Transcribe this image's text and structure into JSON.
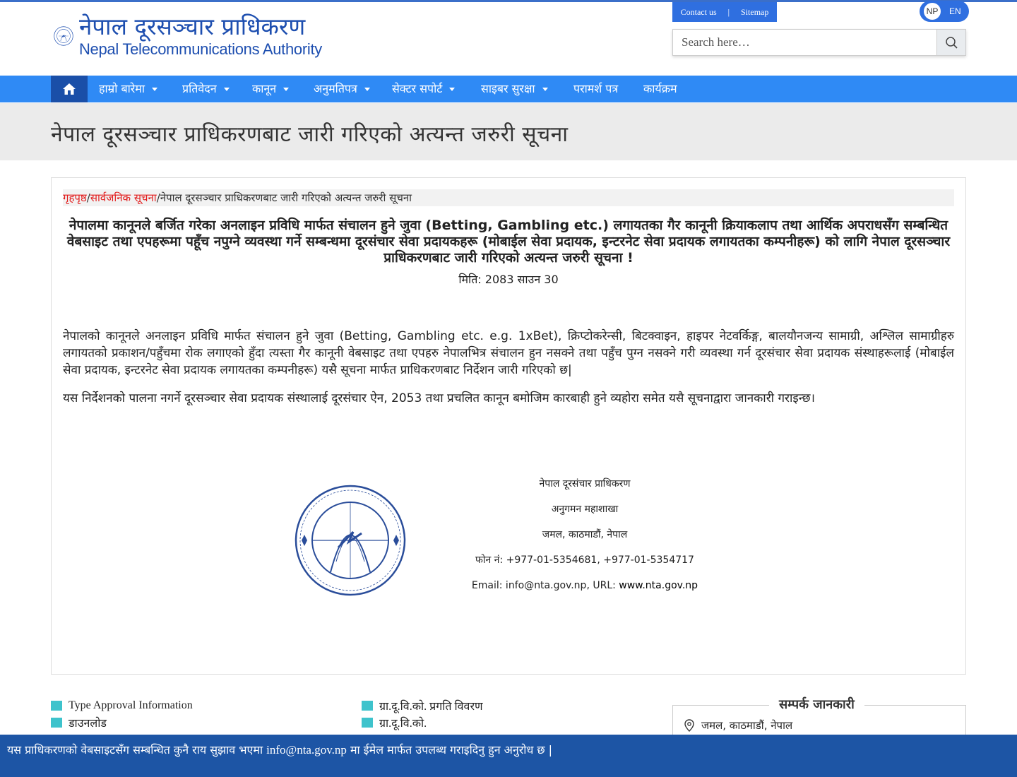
{
  "header": {
    "logo_np": "नेपाल दूरसञ्चार प्राधिकरण",
    "logo_en": "Nepal Telecommunications Authority",
    "contact_label": "Contact us",
    "separator": "|",
    "sitemap_label": "Sitemap",
    "lang_np": "NP",
    "lang_en": "EN",
    "search_placeholder": "Search here…"
  },
  "nav": {
    "items": [
      {
        "label": "हाम्रो बारेमा"
      },
      {
        "label": "प्रतिवेदन"
      },
      {
        "label": "कानून"
      },
      {
        "label": "अनुमतिपत्र"
      },
      {
        "label": "सेक्टर सपोर्ट"
      },
      {
        "label": "साइबर सुरक्षा"
      },
      {
        "label": "परामर्श पत्र"
      },
      {
        "label": "कार्यक्रम"
      }
    ]
  },
  "banner": {
    "title": "नेपाल दूरसञ्चार प्राधिकरणबाट जारी गरिएको अत्यन्त जरुरी सूचना"
  },
  "breadcrumb": {
    "home": "गृहपृष्ठ",
    "sep": "/",
    "section": "सार्वजनिक सूचना",
    "current": "नेपाल दूरसञ्चार प्राधिकरणबाट जारी गरिएको अत्यन्त जरुरी सूचना"
  },
  "notice": {
    "headline": "नेपालमा कानूनले बर्जित गरेका अनलाइन प्रविधि मार्फत संचालन हुने जुवा (Betting, Gambling etc.) लगायतका गैर कानूनी क्रियाकलाप तथा आर्थिक अपराधसँग सम्बन्धित वेबसाइट तथा एपहरूमा पहूँच नपुग्ने व्यवस्था गर्ने सम्बन्धमा  दूरसंचार सेवा प्रदायकहरू (मोबाईल सेवा प्रदायक, इन्टरनेट सेवा प्रदायक लगायतका कम्पनीहरू) को लागि नेपाल दूरसञ्चार प्राधिकरणबाट जारी गरिएको अत्यन्त जरुरी सूचना !",
    "date": "मिति: 2083 साउन 30",
    "para1": "नेपालको कानूनले अनलाइन प्रविधि मार्फत संचालन हुने जुवा (Betting, Gambling etc. e.g. 1xBet), क्रिप्टोकरेन्सी, बिटक्वाइन, हाइपर नेटवर्किङ्ग, बालयौनजन्य सामाग्री, अश्लिल सामाग्रीहरु लगायतको प्रकाशन/पहुँचमा रोक लगाएको हुँदा त्यस्ता गैर कानूनी वेबसाइट तथा एपहरु नेपालभित्र संचालन हुन नसक्ने तथा पहुँच पुग्न नसक्ने गरी व्यवस्था गर्न दूरसंचार सेवा प्रदायक संस्थाहरूलाई (मोबाईल सेवा प्रदायक, इन्टरनेट सेवा प्रदायक लगायतका कम्पनीहरू) यसै सूचना मार्फत प्राधिकरणबाट निर्देशन जारी गरिएको छ|",
    "para2": "यस निर्देशनको पालना नगर्ने दूरसञ्चार सेवा प्रदायक संस्थालाई दूरसंचार ऐन, 2053 तथा प्रचलित कानून बमोजिम कारबाही हुने व्यहोरा समेत यसै सूचनाद्वारा जानकारी गराइन्छ।",
    "sig_org": "नेपाल दूरसंचार प्राधिकरण",
    "sig_dept": "अनुगमन महाशाखा",
    "sig_addr": "जमल, काठमाडौं, नेपाल",
    "sig_phone": "फोन नं: +977-01-5354681, +977-01-5354717",
    "sig_email_prefix": "Email: info@nta.gov.np, URL: ",
    "sig_url": "www.nta.gov.np"
  },
  "footer": {
    "col1": [
      "Type Approval Information",
      "डाउनलोड"
    ],
    "col2": [
      "ग्रा.दू.वि.को. प्रगति विवरण",
      "ग्रा.दू.वि.को."
    ],
    "contact_title": "सम्पर्क जानकारी",
    "contact_address": "जमल, काठमाडौं, नेपाल",
    "bar_text_1": "यस प्राधिकरणको वेबसाइटसँग सम्बन्धित कुनै राय सुझाव भएमा ",
    "bar_email": "info@nta.gov.np",
    "bar_text_2": " मा ईमेल मार्फत उपलब्ध गराइदिनु हुन अनुरोध छ |"
  },
  "colors": {
    "nav": "#2f8af5",
    "nav_home": "#1a4fa8",
    "accent_red": "#e21b1b",
    "bottom_bar": "#1d55a5",
    "list_marker": "#3ec3cc"
  },
  "icons": [
    "home-icon",
    "search-icon",
    "location-icon"
  ]
}
